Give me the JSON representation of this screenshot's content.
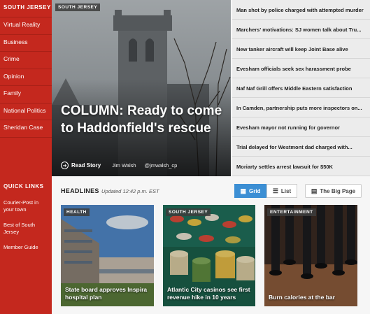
{
  "sidebar": {
    "title": "SOUTH JERSEY",
    "items": [
      "Virtual Reality",
      "Business",
      "Crime",
      "Opinion",
      "Family",
      "National Politics",
      "Sheridan Case"
    ],
    "quick_links_title": "QUICK LINKS",
    "quick_links": [
      "Courier-Post in your town",
      "Best of South Jersey",
      "Member Guide"
    ]
  },
  "hero": {
    "tag": "SOUTH JERSEY",
    "title": "COLUMN: Ready to come to Haddonfield's rescue",
    "read_label": "Read Story",
    "author": "Jim Walsh",
    "handle": "@jmwalsh_cp"
  },
  "news": [
    "Man shot by police charged with attempted murder",
    "Marchers' motivations: SJ women talk about Tru...",
    "New tanker aircraft will keep Joint Base alive",
    "Evesham officials seek sex harassment probe",
    "Naf Naf Grill offers Middle Eastern satisfaction",
    "In Camden, partnership puts more inspectors on...",
    "Evesham mayor not running for governor",
    "Trial delayed for Westmont dad charged with...",
    "Moriarty settles arrest lawsuit for $50K"
  ],
  "headlines": {
    "title": "HEADLINES",
    "updated": "Updated 12:42 p.m. EST",
    "grid_label": "Grid",
    "list_label": "List",
    "big_page_label": "The Big Page"
  },
  "cards": [
    {
      "tag": "HEALTH",
      "title": "State board approves Inspira hospital plan"
    },
    {
      "tag": "SOUTH JERSEY",
      "title": "Atlantic City casinos see first revenue hike in 10 years"
    },
    {
      "tag": "ENTERTAINMENT",
      "title": "Burn calories at the bar"
    }
  ],
  "colors": {
    "sidebar": "#c4281e",
    "accent": "#3c8fd4"
  }
}
